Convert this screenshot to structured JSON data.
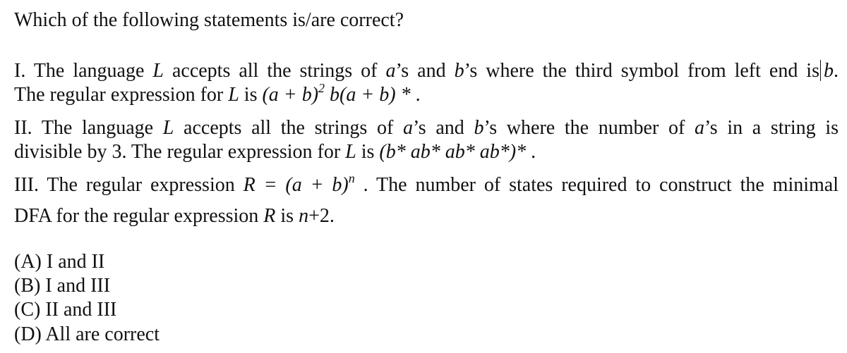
{
  "question": {
    "title": "Which of the following statements is/are correct?"
  },
  "statements": [
    {
      "number": "I.",
      "line1": {
        "t1": " The language ",
        "L": "L",
        "t2": " accepts all the strings of ",
        "a": "a",
        "t3": "’s and ",
        "b": "b",
        "t4": "’s where the third symbol from left end is",
        "b2": "b",
        "t5": "."
      },
      "line2": {
        "t1": "The regular expression for ",
        "L": "L",
        "t2": " is ",
        "expr_pre": "(a + b)",
        "expr_sup": "2",
        "expr_post": " b(a + b) *",
        "t3": " ."
      }
    },
    {
      "number": "II.",
      "line1": {
        "t1": " The language ",
        "L": "L",
        "t2": " accepts all the strings of ",
        "a": "a",
        "t3": "’s and ",
        "b": "b",
        "t4": "’s where the number of ",
        "a2": "a",
        "t5": "’s in a string is"
      },
      "line2": {
        "t1": "divisible by 3. The regular expression for ",
        "L": "L",
        "t2": " is ",
        "expr": "(b* ab* ab* ab*)*",
        "t3": " ."
      }
    },
    {
      "number": "III.",
      "line1": {
        "t1": " The regular expression ",
        "expr_pre": "R = (a + b)",
        "expr_sup": "n",
        "t2": " . The number of states required to construct the minimal"
      },
      "line2": {
        "t1": "DFA for the regular expression ",
        "R": "R",
        "t2": " is ",
        "n": "n",
        "t3": "+2."
      }
    }
  ],
  "options": [
    {
      "label": "(A)",
      "text": " I and II"
    },
    {
      "label": "(B)",
      "text": " I and III"
    },
    {
      "label": "(C)",
      "text": " II and III"
    },
    {
      "label": "(D)",
      "text": " All are correct"
    }
  ]
}
